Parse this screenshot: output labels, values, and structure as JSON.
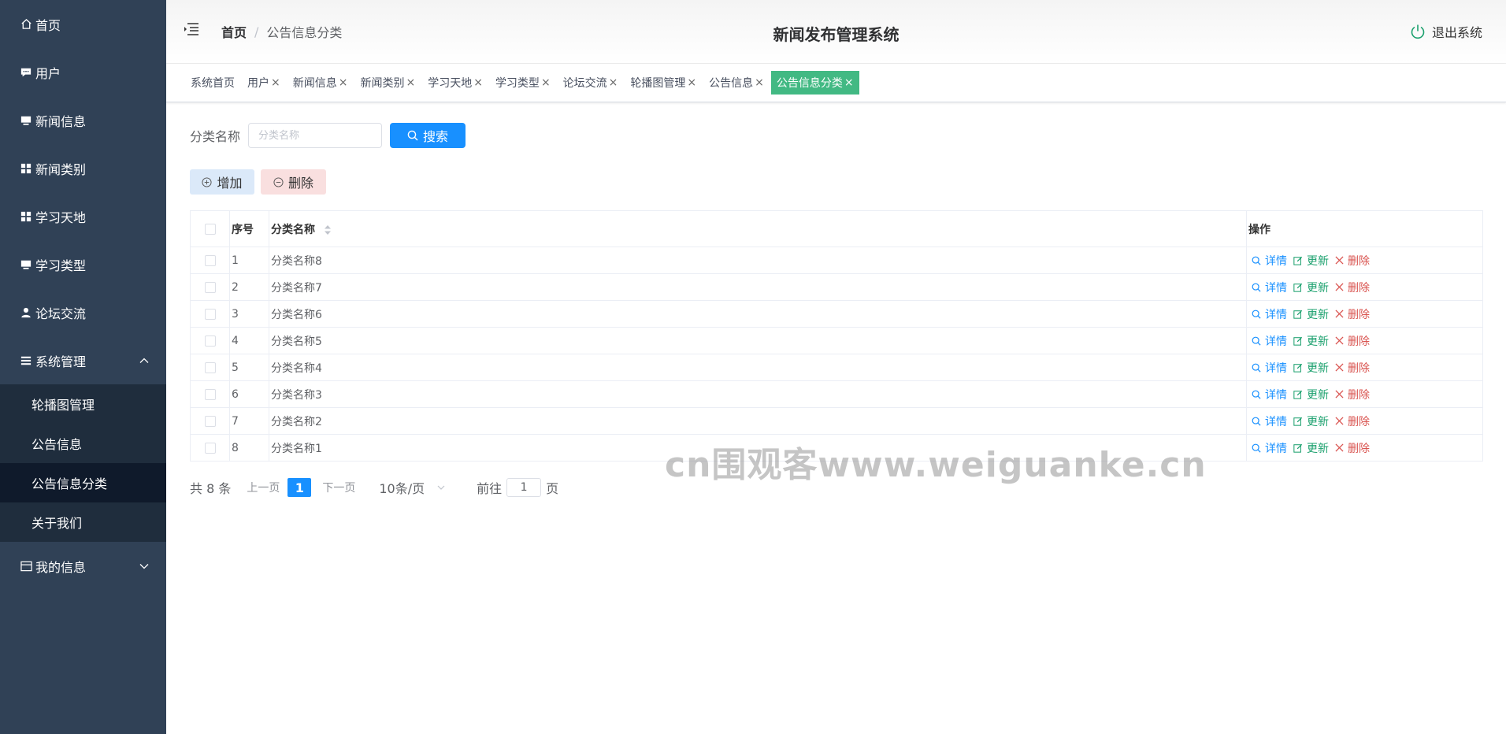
{
  "sidebar": {
    "items": [
      {
        "label": "首页",
        "icon": "home-icon"
      },
      {
        "label": "用户",
        "icon": "chat-icon"
      },
      {
        "label": "新闻信息",
        "icon": "monitor-icon"
      },
      {
        "label": "新闻类别",
        "icon": "grid-icon"
      },
      {
        "label": "学习天地",
        "icon": "grid-icon"
      },
      {
        "label": "学习类型",
        "icon": "monitor-icon"
      },
      {
        "label": "论坛交流",
        "icon": "user-icon"
      },
      {
        "label": "系统管理",
        "icon": "menu-icon"
      }
    ],
    "submenu": [
      "轮播图管理",
      "公告信息",
      "公告信息分类",
      "关于我们"
    ],
    "my_info": {
      "label": "我的信息",
      "icon": "card-icon"
    }
  },
  "header": {
    "breadcrumb_home": "首页",
    "breadcrumb_sep": "/",
    "breadcrumb_current": "公告信息分类",
    "title": "新闻发布管理系统",
    "logout": "退出系统"
  },
  "tags": [
    {
      "label": "系统首页",
      "closable": false
    },
    {
      "label": "用户",
      "closable": true
    },
    {
      "label": "新闻信息",
      "closable": true
    },
    {
      "label": "新闻类别",
      "closable": true
    },
    {
      "label": "学习天地",
      "closable": true
    },
    {
      "label": "学习类型",
      "closable": true
    },
    {
      "label": "论坛交流",
      "closable": true
    },
    {
      "label": "轮播图管理",
      "closable": true
    },
    {
      "label": "公告信息",
      "closable": true
    },
    {
      "label": "公告信息分类",
      "closable": true
    }
  ],
  "tag_close": "×",
  "search": {
    "label": "分类名称",
    "placeholder": "分类名称",
    "button": "搜索"
  },
  "actions": {
    "add": "增加",
    "delete": "删除"
  },
  "table": {
    "headers": {
      "index": "序号",
      "name": "分类名称",
      "ops": "操作"
    },
    "rows": [
      {
        "index": "1",
        "name": "分类名称8"
      },
      {
        "index": "2",
        "name": "分类名称7"
      },
      {
        "index": "3",
        "name": "分类名称6"
      },
      {
        "index": "4",
        "name": "分类名称5"
      },
      {
        "index": "5",
        "name": "分类名称4"
      },
      {
        "index": "6",
        "name": "分类名称3"
      },
      {
        "index": "7",
        "name": "分类名称2"
      },
      {
        "index": "8",
        "name": "分类名称1"
      }
    ],
    "op_labels": {
      "detail": "详情",
      "update": "更新",
      "delete": "删除"
    }
  },
  "pager": {
    "total": "共 8 条",
    "prev": "上一页",
    "page": "1",
    "next": "下一页",
    "size": "10条/页",
    "goto_prefix": "前往",
    "goto_value": "1",
    "goto_suffix": "页"
  },
  "watermark": "cn围观客www.weiguanke.cn",
  "colors": {
    "sidebar_bg": "#304156",
    "submenu_bg": "#1f2d3d",
    "active_tag": "#42b983",
    "primary": "#1890ff"
  }
}
